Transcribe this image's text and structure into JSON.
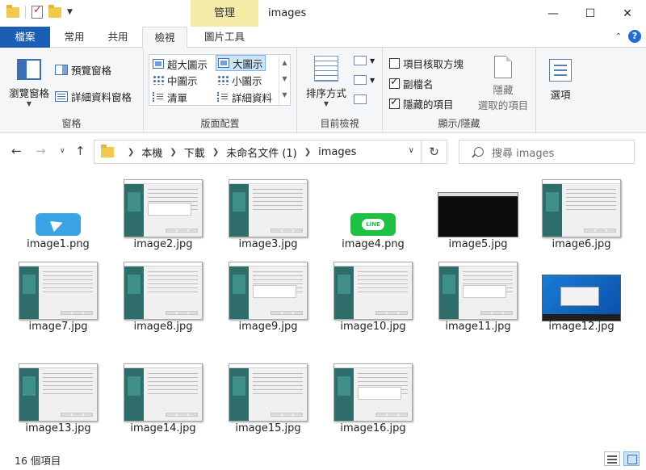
{
  "window": {
    "title": "images",
    "context_tab": "管理",
    "controls": {
      "minimize": "—",
      "maximize": "☐",
      "close": "✕"
    }
  },
  "ribbon_tabs": [
    {
      "label": "檔案"
    },
    {
      "label": "常用"
    },
    {
      "label": "共用"
    },
    {
      "label": "檢視"
    },
    {
      "label": "圖片工具"
    }
  ],
  "ribbon": {
    "panes": {
      "navigation_pane": "瀏覽窗格",
      "preview_pane": "預覽窗格",
      "details_pane": "詳細資料窗格",
      "label": "窗格"
    },
    "layout": {
      "items": [
        "超大圖示",
        "大圖示",
        "中圖示",
        "小圖示",
        "清單",
        "詳細資料"
      ],
      "selected": "大圖示",
      "label": "版面配置"
    },
    "current_view": {
      "sort_by": "排序方式",
      "label": "目前檢視"
    },
    "show_hide": {
      "item_checkboxes": {
        "label": "項目核取方塊",
        "checked": false
      },
      "file_extensions": {
        "label": "副檔名",
        "checked": true
      },
      "hidden_items": {
        "label": "隱藏的項目",
        "checked": true
      },
      "hide_selected_line1": "隱藏",
      "hide_selected_line2": "選取的項目",
      "label": "顯示/隱藏"
    },
    "options": "選項"
  },
  "address": {
    "breadcrumb": [
      "本機",
      "下載",
      "未命名文件 (1)",
      "images"
    ]
  },
  "search": {
    "placeholder": "搜尋 images"
  },
  "files": [
    {
      "name": "image1.png",
      "kind": "telegram-icon"
    },
    {
      "name": "image2.jpg",
      "kind": "dialog"
    },
    {
      "name": "image3.jpg",
      "kind": "dialog"
    },
    {
      "name": "image4.png",
      "kind": "line-icon"
    },
    {
      "name": "image5.jpg",
      "kind": "terminal"
    },
    {
      "name": "image6.jpg",
      "kind": "dialog"
    },
    {
      "name": "image7.jpg",
      "kind": "dialog"
    },
    {
      "name": "image8.jpg",
      "kind": "dialog"
    },
    {
      "name": "image9.jpg",
      "kind": "dialog"
    },
    {
      "name": "image10.jpg",
      "kind": "dialog"
    },
    {
      "name": "image11.jpg",
      "kind": "dialog"
    },
    {
      "name": "image12.jpg",
      "kind": "desktop"
    },
    {
      "name": "image13.jpg",
      "kind": "dialog"
    },
    {
      "name": "image14.jpg",
      "kind": "dialog"
    },
    {
      "name": "image15.jpg",
      "kind": "dialog"
    },
    {
      "name": "image16.jpg",
      "kind": "dialog"
    }
  ],
  "status": {
    "item_count": "16 個項目"
  },
  "colors": {
    "file_tab": "#1a5fb4",
    "context_tab": "#f6ecaa",
    "selection": "#cce4f7"
  }
}
